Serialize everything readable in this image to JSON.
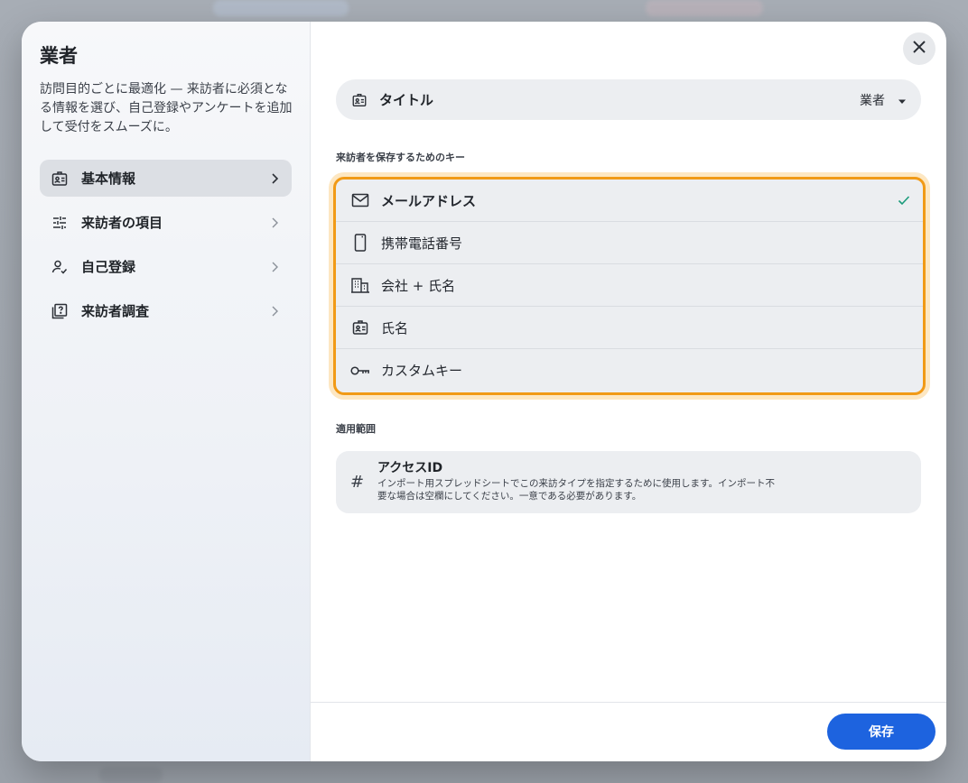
{
  "sidebar": {
    "title": "業者",
    "description": "訪問目的ごとに最適化 — 来訪者に必須となる情報を選び、自己登録やアンケートを追加して受付をスムーズに。",
    "items": [
      {
        "label": "基本情報",
        "icon": "id-card-icon",
        "active": true
      },
      {
        "label": "来訪者の項目",
        "icon": "sliders-icon",
        "active": false
      },
      {
        "label": "自己登録",
        "icon": "user-check-icon",
        "active": false
      },
      {
        "label": "来訪者調査",
        "icon": "survey-icon",
        "active": false
      }
    ]
  },
  "title_field": {
    "label": "タイトル",
    "value": "業者",
    "icon": "id-card-icon"
  },
  "keys_section": {
    "label": "来訪者を保存するためのキー",
    "options": [
      {
        "label": "メールアドレス",
        "icon": "mail-icon",
        "selected": true
      },
      {
        "label": "携帯電話番号",
        "icon": "phone-icon",
        "selected": false
      },
      {
        "label": "会社 + 氏名",
        "icon": "building-icon",
        "selected": false
      },
      {
        "label": "氏名",
        "icon": "id-card-icon",
        "selected": false
      },
      {
        "label": "カスタムキー",
        "icon": "key-icon",
        "selected": false
      }
    ]
  },
  "scope_section": {
    "label": "適用範囲"
  },
  "access_id": {
    "title": "アクセスID",
    "description": "インポート用スプレッドシートでこの来訪タイプを指定するために使用します。インポート不要な場合は空欄にしてください。一意である必要があります。",
    "icon": "hash-icon"
  },
  "footer": {
    "save_label": "保存"
  },
  "colors": {
    "accent": "#1d63df",
    "highlight": "#f19a16",
    "check": "#1a9b7b"
  }
}
